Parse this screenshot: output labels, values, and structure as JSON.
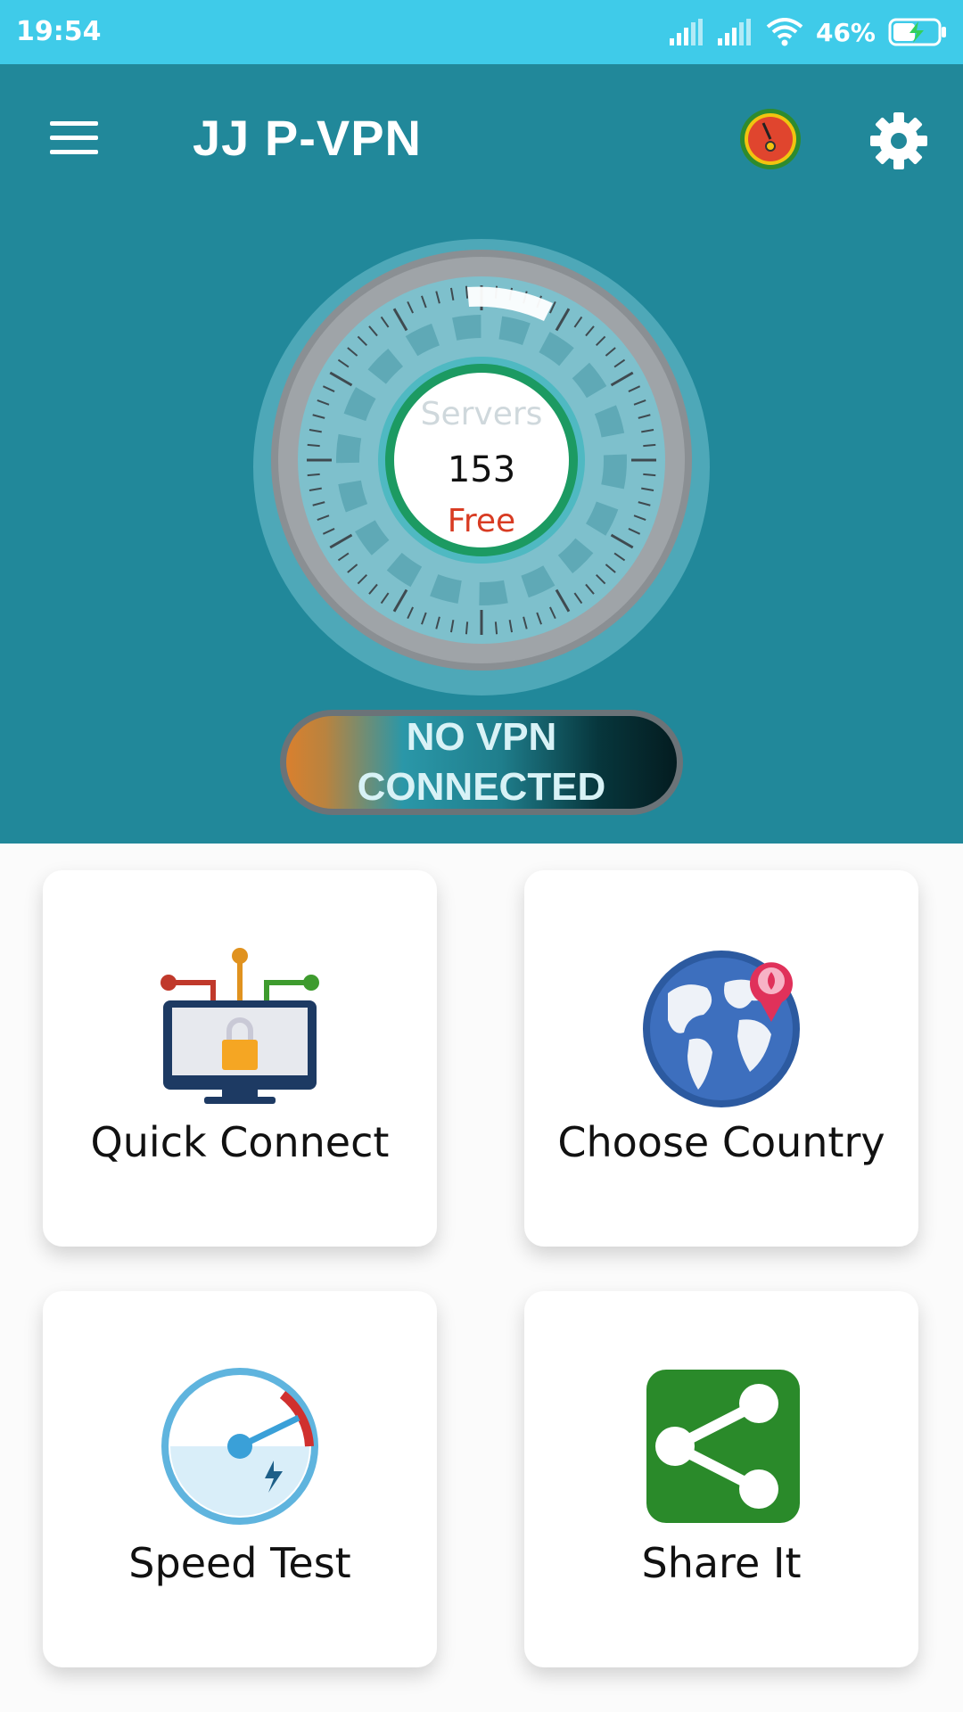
{
  "status_bar": {
    "time": "19:54",
    "battery": "46%"
  },
  "header": {
    "title": "JJ P-VPN"
  },
  "dial": {
    "servers_label": "Servers",
    "servers_count": "153",
    "plan": "Free"
  },
  "vpn_status": {
    "line1": "NO VPN",
    "line2": "CONNECTED"
  },
  "cards": {
    "quick_connect": "Quick Connect",
    "choose_country": "Choose Country",
    "speed_test": "Speed Test",
    "share_it": "Share It"
  },
  "colors": {
    "status_bar": "#3fcbe9",
    "header_bg": "#21889a",
    "free_text": "#d83b22"
  }
}
